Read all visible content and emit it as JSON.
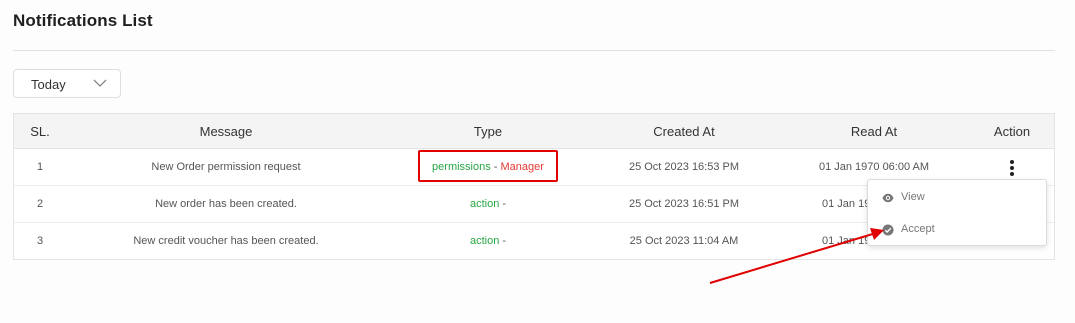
{
  "page": {
    "title": "Notifications List"
  },
  "filter": {
    "selected": "Today"
  },
  "table": {
    "headers": [
      "SL.",
      "Message",
      "Type",
      "Created At",
      "Read At",
      "Action"
    ],
    "rows": [
      {
        "sl": "1",
        "message": "New Order permission request",
        "type_main": "permissions",
        "type_sep": " - ",
        "type_sub": "Manager",
        "created_at": "25 Oct 2023 16:53 PM",
        "read_at": "01 Jan 1970 06:00 AM"
      },
      {
        "sl": "2",
        "message": "New order has been created.",
        "type_main": "action",
        "type_sep": " -",
        "type_sub": "",
        "created_at": "25 Oct 2023 16:51 PM",
        "read_at": "01 Jan 197"
      },
      {
        "sl": "3",
        "message": "New credit voucher has been created.",
        "type_main": "action",
        "type_sep": " -",
        "type_sub": "",
        "created_at": "25 Oct 2023 11:04 AM",
        "read_at": "01 Jan 19"
      }
    ]
  },
  "action_menu": {
    "items": [
      {
        "label": "View",
        "icon": "eye-icon"
      },
      {
        "label": "Accept",
        "icon": "check-circle-icon"
      }
    ]
  },
  "colors": {
    "green": "#28a745",
    "red": "#e53935",
    "highlight": "#e00000"
  }
}
